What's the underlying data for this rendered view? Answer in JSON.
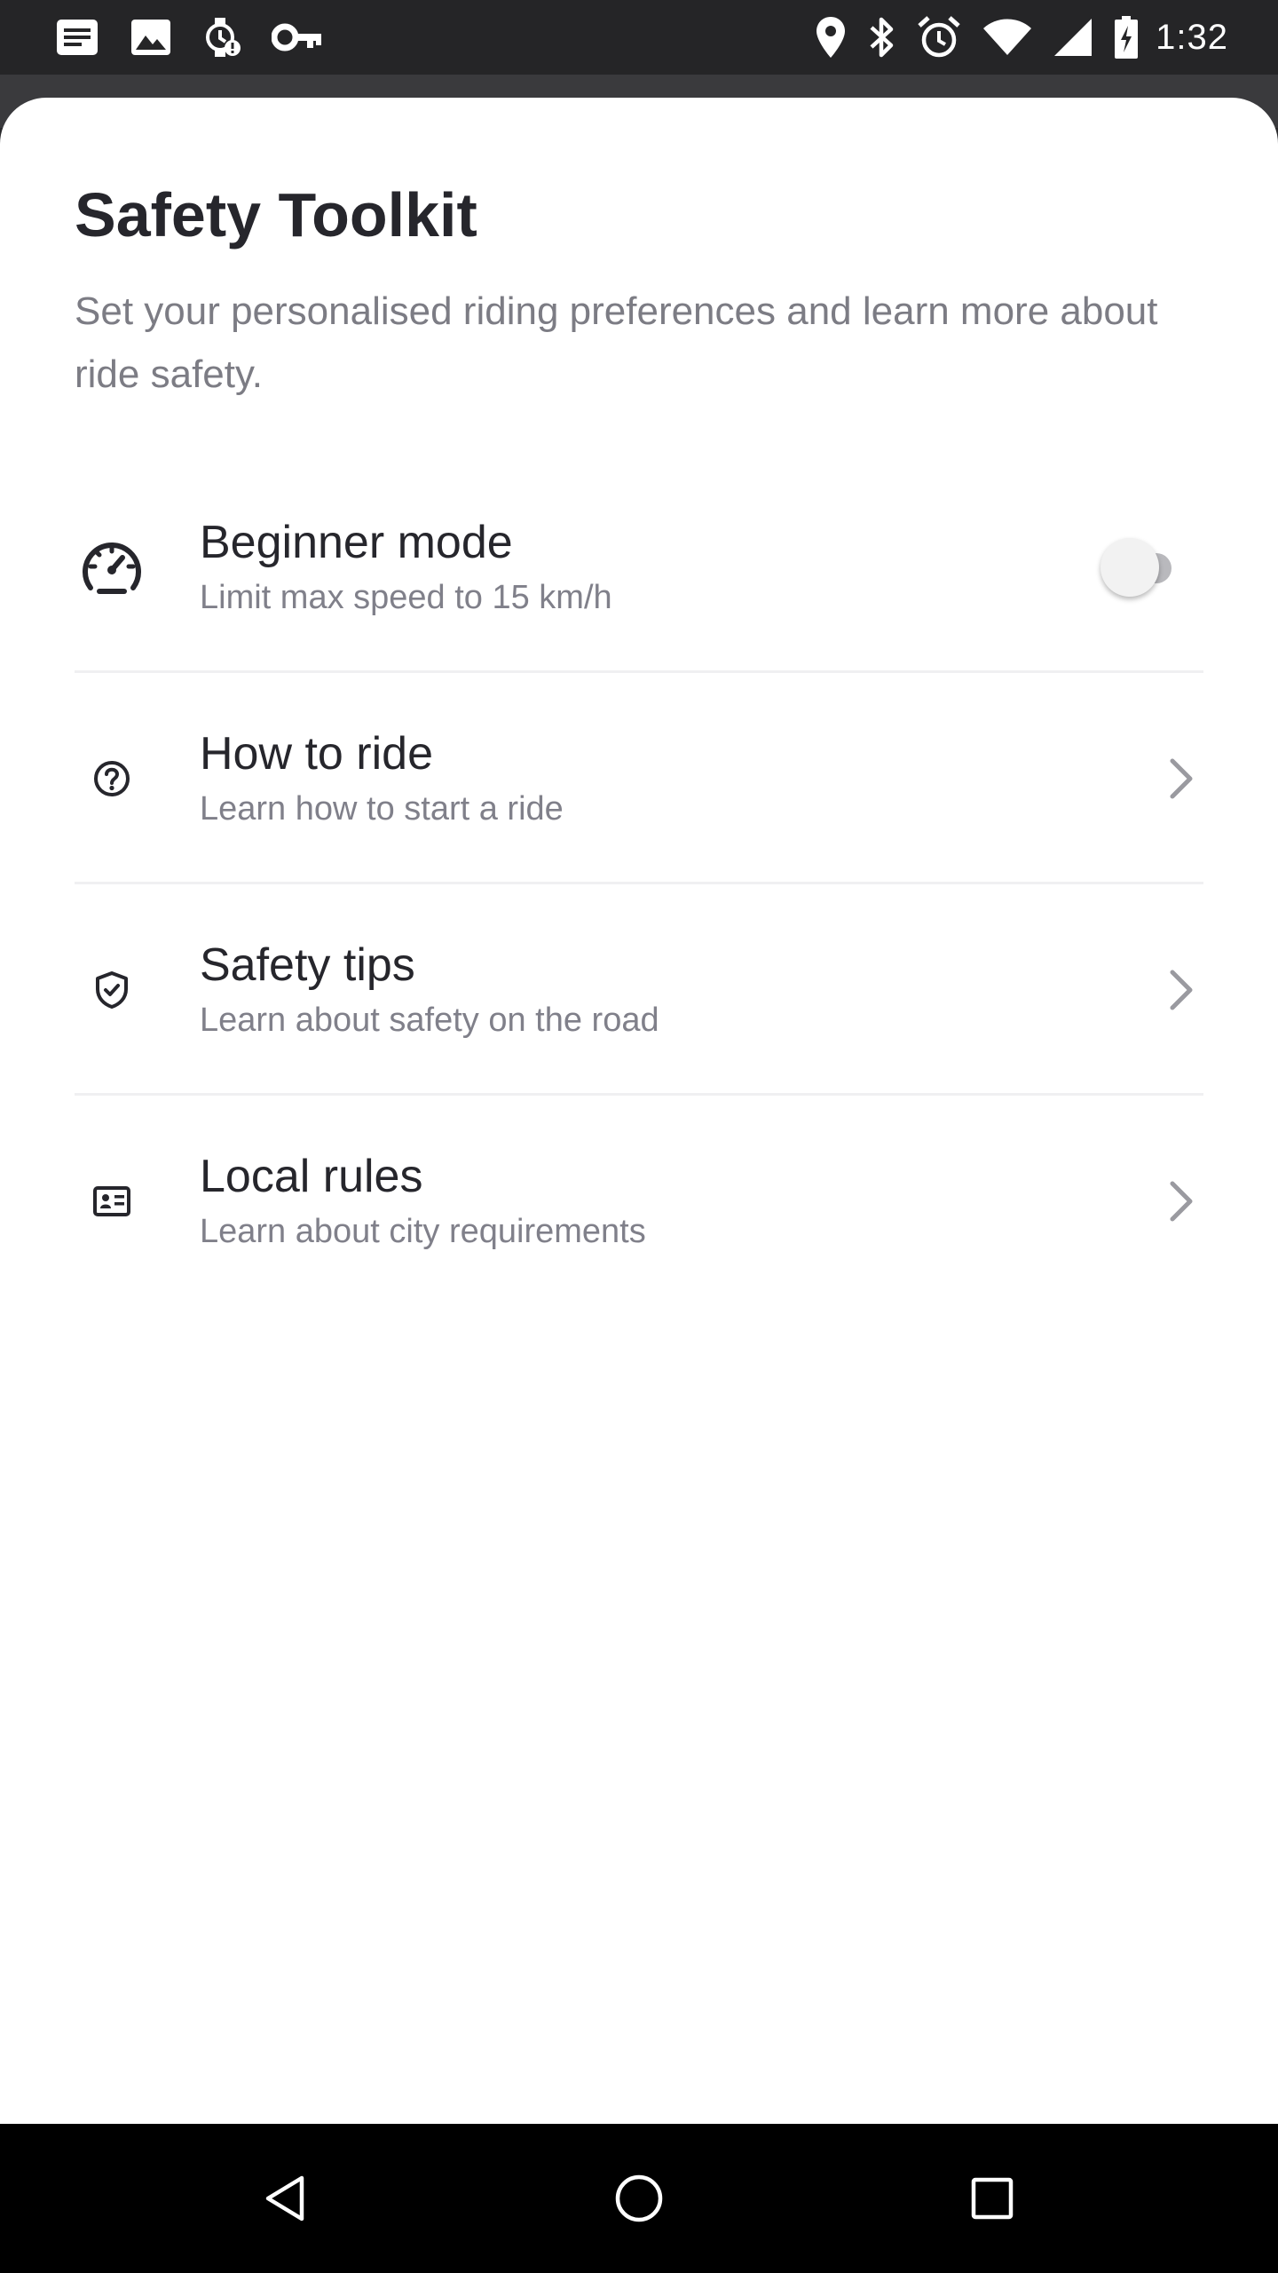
{
  "status_bar": {
    "time": "1:32",
    "left_icons": [
      "notes-icon",
      "image-icon",
      "watch-alert-icon",
      "key-icon"
    ],
    "right_icons": [
      "location-icon",
      "bluetooth-icon",
      "alarm-icon",
      "wifi-icon",
      "cell-signal-icon",
      "battery-charging-icon"
    ]
  },
  "sheet": {
    "title": "Safety Toolkit",
    "subtitle": "Set your personalised riding preferences and learn more about ride safety."
  },
  "items": [
    {
      "icon": "speedometer-icon",
      "title": "Beginner mode",
      "subtitle": "Limit max speed to 15 km/h",
      "control": "toggle",
      "toggle_on": false
    },
    {
      "icon": "help-circle-icon",
      "title": "How to ride",
      "subtitle": "Learn how to start a ride",
      "control": "chevron"
    },
    {
      "icon": "shield-check-icon",
      "title": "Safety tips",
      "subtitle": "Learn about safety on the road",
      "control": "chevron"
    },
    {
      "icon": "id-card-icon",
      "title": "Local rules",
      "subtitle": "Learn about city requirements",
      "control": "chevron"
    }
  ],
  "nav_bar": {
    "buttons": [
      "back-icon",
      "home-icon",
      "recents-icon"
    ]
  },
  "colors": {
    "title": "#26262c",
    "subtitle": "#7c7c84",
    "divider": "#f0f0f2",
    "toggle_track": "#b9b9bd",
    "chevron": "#9a9aa0"
  }
}
